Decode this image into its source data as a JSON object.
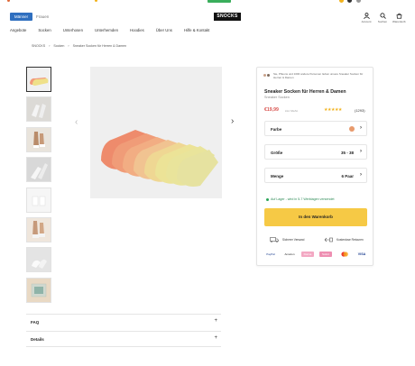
{
  "header": {
    "gender_active": "Männer",
    "gender_other": "Frauen",
    "logo": "SNOCKS",
    "icons": [
      {
        "name": "account-icon",
        "label": "Account"
      },
      {
        "name": "search-icon",
        "label": "Suchen"
      },
      {
        "name": "cart-icon",
        "label": "Warenkorb"
      }
    ]
  },
  "nav": [
    "Angebote",
    "Socken",
    "Unterhosen",
    "Unterhemden",
    "Hoodies",
    "Über Uns",
    "Hilfe & Kontakt"
  ],
  "breadcrumb": [
    "SNOCKS",
    "›",
    "Socken",
    "›",
    "Sneaker Socken für Herren & Damen"
  ],
  "product": {
    "social_proof": "Sie, Pfleuns und 1000 andere Personen lieben unsere Sneaker Socken für Herren & Damen",
    "title": "Sneaker Socken für Herren & Damen",
    "subtitle": "Sneaker Socken",
    "price": "€19,99",
    "vat": "inkl. MwSt.",
    "stars": "★★★★★",
    "rating_value": 5,
    "reviews": "(1293)",
    "options": [
      {
        "name": "color-option",
        "label": "Farbe",
        "value": ""
      },
      {
        "name": "size-option",
        "label": "Größe",
        "value": "35 - 38"
      },
      {
        "name": "quantity-option",
        "label": "Menge",
        "value": "6 Paar"
      }
    ],
    "stock": "Auf Lager - wird in 5-7 Werktagen versendet",
    "cart_button": "In den Warenkorb",
    "services": [
      "Sicherer Versand",
      "Kostenlose Retouren"
    ],
    "payments": [
      "PayPal",
      "Amazon",
      "Klarna",
      "Sofort",
      "Mastercard",
      "VISA"
    ]
  },
  "accordions": [
    "FAQ",
    "Details"
  ],
  "colors": {
    "accent_blue": "#2f6fbf",
    "cart_yellow": "#f6c945",
    "price_red": "#d9534f",
    "stock_green": "#2aa55a"
  }
}
